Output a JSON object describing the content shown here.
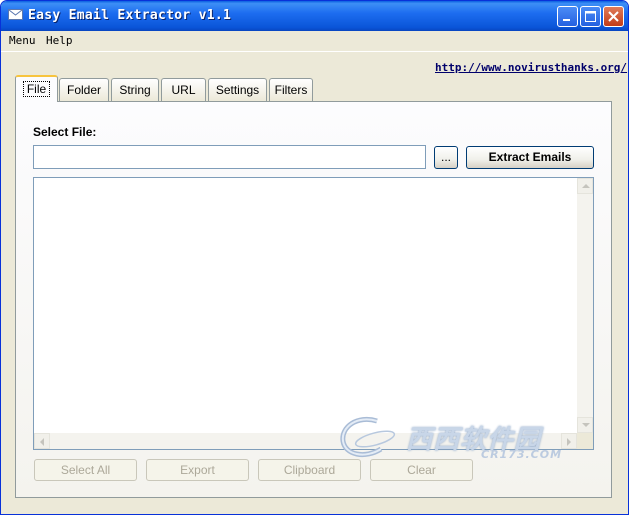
{
  "window": {
    "title": "Easy Email Extractor v1.1"
  },
  "menubar": {
    "items": [
      "Menu",
      "Help"
    ]
  },
  "header": {
    "link": "http://www.novirusthanks.org/"
  },
  "tabs": [
    {
      "label": "File",
      "active": true
    },
    {
      "label": "Folder",
      "active": false
    },
    {
      "label": "String",
      "active": false
    },
    {
      "label": "URL",
      "active": false
    },
    {
      "label": "Settings",
      "active": false
    },
    {
      "label": "Filters",
      "active": false
    }
  ],
  "file_panel": {
    "select_label": "Select File:",
    "file_value": "",
    "browse_label": "...",
    "extract_label": "Extract Emails"
  },
  "actions": {
    "select_all": "Select All",
    "export": "Export",
    "clipboard": "Clipboard",
    "clear": "Clear"
  },
  "watermark": {
    "text": "西西软件园",
    "sub": "CR173.COM"
  },
  "colors": {
    "title_bar": "#0a55d8",
    "link": "#00006b",
    "active_tab_accent": "#f7c43e"
  }
}
